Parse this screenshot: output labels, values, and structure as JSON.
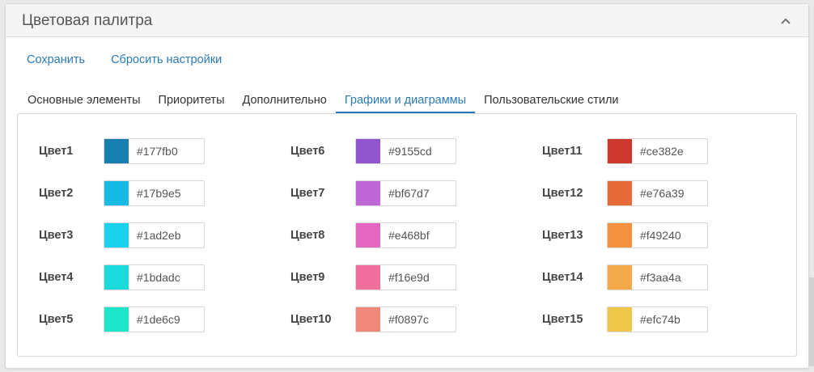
{
  "panel": {
    "title": "Цветовая палитра"
  },
  "actions": {
    "save": "Сохранить",
    "reset": "Сбросить настройки"
  },
  "tabs": [
    {
      "label": "Основные элементы",
      "active": false
    },
    {
      "label": "Приоритеты",
      "active": false
    },
    {
      "label": "Дополнительно",
      "active": false
    },
    {
      "label": "Графики и диаграммы",
      "active": true
    },
    {
      "label": "Пользовательские стили",
      "active": false
    }
  ],
  "colors": [
    {
      "label": "Цвет1",
      "value": "#177fb0"
    },
    {
      "label": "Цвет2",
      "value": "#17b9e5"
    },
    {
      "label": "Цвет3",
      "value": "#1ad2eb"
    },
    {
      "label": "Цвет4",
      "value": "#1bdadc"
    },
    {
      "label": "Цвет5",
      "value": "#1de6c9"
    },
    {
      "label": "Цвет6",
      "value": "#9155cd"
    },
    {
      "label": "Цвет7",
      "value": "#bf67d7"
    },
    {
      "label": "Цвет8",
      "value": "#e468bf"
    },
    {
      "label": "Цвет9",
      "value": "#f16e9d"
    },
    {
      "label": "Цвет10",
      "value": "#f0897c"
    },
    {
      "label": "Цвет11",
      "value": "#ce382e"
    },
    {
      "label": "Цвет12",
      "value": "#e76a39"
    },
    {
      "label": "Цвет13",
      "value": "#f49240"
    },
    {
      "label": "Цвет14",
      "value": "#f3aa4a"
    },
    {
      "label": "Цвет15",
      "value": "#efc74b"
    }
  ],
  "icons": {
    "collapse": "chevron-up-icon"
  },
  "accent": "#2a7ab8"
}
